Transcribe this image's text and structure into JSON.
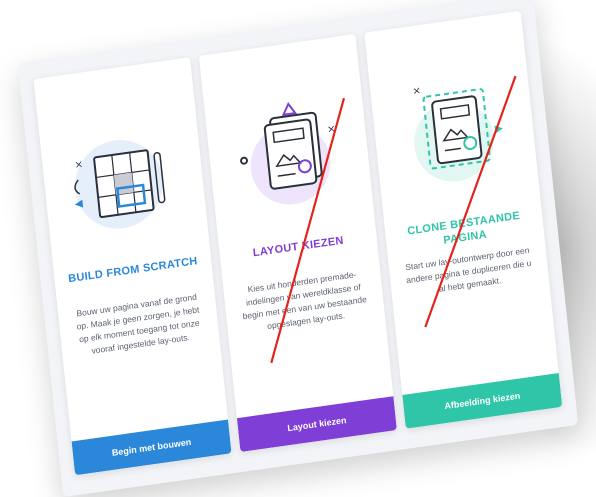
{
  "colors": {
    "blue": "#2b87da",
    "purple": "#7f3ed6",
    "teal": "#2fc5a8",
    "title_blue": "#2b87da",
    "title_purple": "#7f3ed6",
    "title_teal": "#2fc5a8",
    "red_strike": "#e5221a"
  },
  "cards": [
    {
      "title": "BUILD FROM SCRATCH",
      "description": "Bouw uw pagina vanaf de grond op. Maak je geen zorgen, je hebt op elk moment toegang tot onze vooraf ingestelde lay-outs.",
      "button": "Begin met bouwen",
      "icon": "blueprint-grid-icon"
    },
    {
      "title": "LAYOUT KIEZEN",
      "description": "Kies uit honderden premade-indelingen van wereldklasse of begin met een van uw bestaande opgeslagen lay-outs.",
      "button": "Layout kiezen",
      "icon": "layout-document-icon"
    },
    {
      "title": "CLONE BESTAANDE PAGINA",
      "description": "Start uw lay-outontwerp door een andere pagina te dupliceren die u al hebt gemaakt.",
      "button": "Afbeelding kiezen",
      "icon": "clone-document-icon"
    }
  ]
}
